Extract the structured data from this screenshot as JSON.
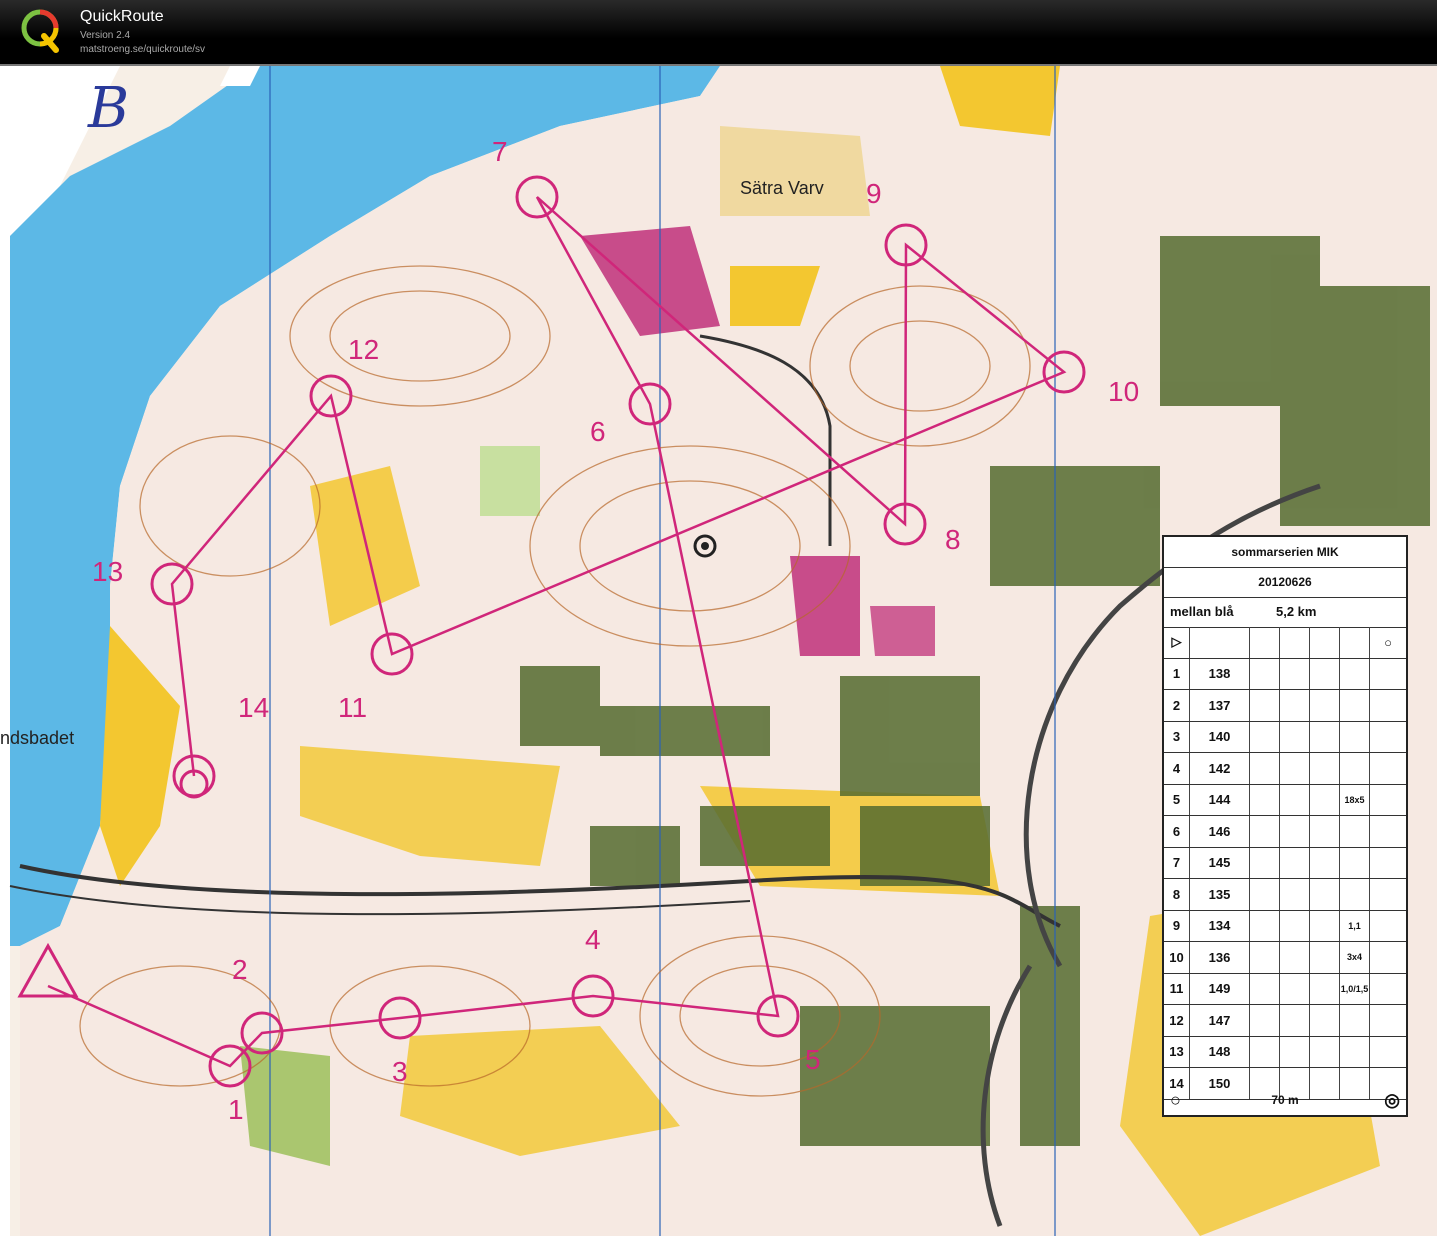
{
  "window": {
    "app_name": "QuickRoute",
    "version": "Version 2.4",
    "url": "matstroeng.se/quickroute/sv"
  },
  "map": {
    "handwritten_mark": "B",
    "place_labels": [
      "Sätra Varv",
      "ndsbadet"
    ],
    "control_labels": [
      "1",
      "2",
      "3",
      "4",
      "5",
      "6",
      "7",
      "8",
      "9",
      "10",
      "11",
      "12",
      "13",
      "14"
    ],
    "colors": {
      "water": "#5cb8e6",
      "open_land": "#f3c730",
      "forest": "#f8f1ea",
      "green": "#9cc05a",
      "course": "#d0267a",
      "buildings": "#556b2f",
      "contours": "#b8682a"
    }
  },
  "control_description": {
    "title": "sommarserien MIK",
    "date": "20120626",
    "class": "mellan blå",
    "length": "5,2 km",
    "rows": [
      {
        "num": "1",
        "code": "138",
        "dim": ""
      },
      {
        "num": "2",
        "code": "137",
        "dim": ""
      },
      {
        "num": "3",
        "code": "140",
        "dim": ""
      },
      {
        "num": "4",
        "code": "142",
        "dim": ""
      },
      {
        "num": "5",
        "code": "144",
        "dim": "18x5"
      },
      {
        "num": "6",
        "code": "146",
        "dim": ""
      },
      {
        "num": "7",
        "code": "145",
        "dim": ""
      },
      {
        "num": "8",
        "code": "135",
        "dim": ""
      },
      {
        "num": "9",
        "code": "134",
        "dim": "1,1"
      },
      {
        "num": "10",
        "code": "136",
        "dim": "3x4"
      },
      {
        "num": "11",
        "code": "149",
        "dim": "1,0/1,5"
      },
      {
        "num": "12",
        "code": "147",
        "dim": ""
      },
      {
        "num": "13",
        "code": "148",
        "dim": ""
      },
      {
        "num": "14",
        "code": "150",
        "dim": ""
      }
    ],
    "finish_distance": "70 m"
  }
}
